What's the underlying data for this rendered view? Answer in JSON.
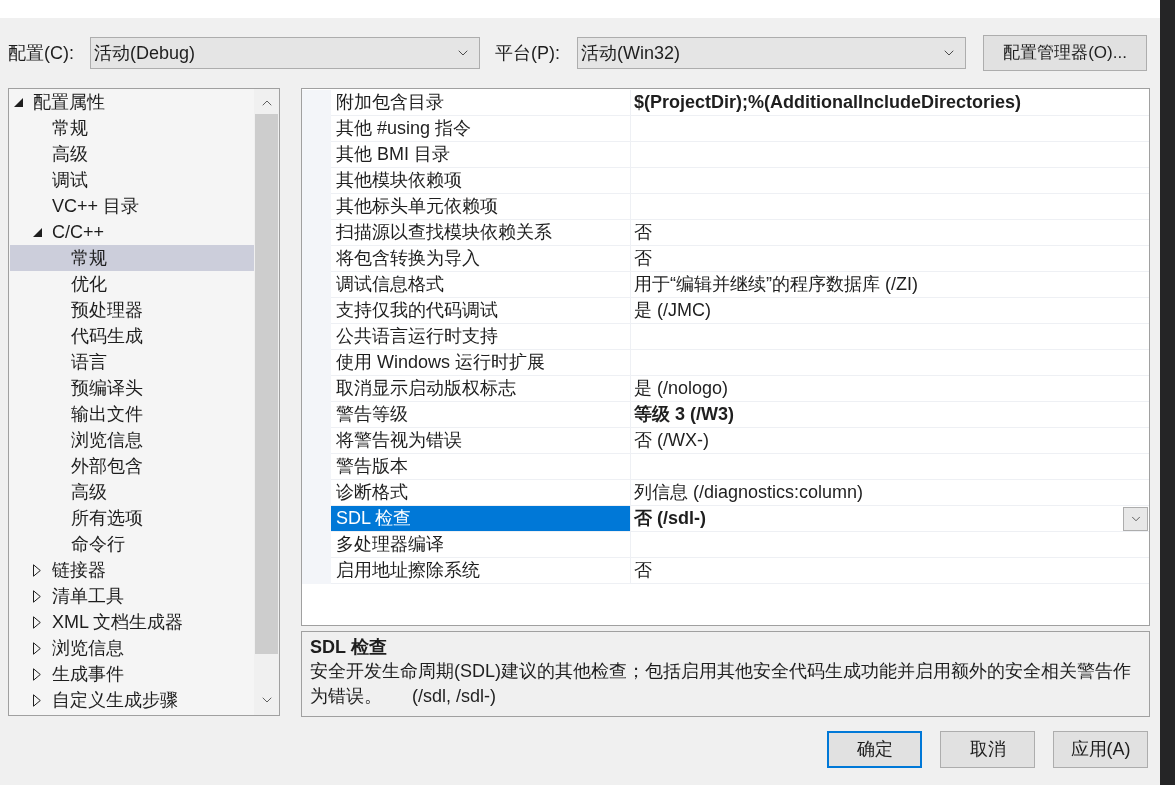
{
  "toolbar": {
    "configuration": {
      "label": "配置(C):",
      "value": "活动(Debug)"
    },
    "platform": {
      "label": "平台(P):",
      "value": "活动(Win32)"
    },
    "manager_button": "配置管理器(O)..."
  },
  "tree": [
    {
      "label": "配置属性",
      "expanded": true,
      "selected": false,
      "children": [
        {
          "label": "常规",
          "selected": false
        },
        {
          "label": "高级",
          "selected": false
        },
        {
          "label": "调试",
          "selected": false
        },
        {
          "label": "VC++ 目录",
          "selected": false
        },
        {
          "label": "C/C++",
          "expanded": true,
          "selected": false,
          "children": [
            {
              "label": "常规",
              "selected": true
            },
            {
              "label": "优化",
              "selected": false
            },
            {
              "label": "预处理器",
              "selected": false
            },
            {
              "label": "代码生成",
              "selected": false
            },
            {
              "label": "语言",
              "selected": false
            },
            {
              "label": "预编译头",
              "selected": false
            },
            {
              "label": "输出文件",
              "selected": false
            },
            {
              "label": "浏览信息",
              "selected": false
            },
            {
              "label": "外部包含",
              "selected": false
            },
            {
              "label": "高级",
              "selected": false
            },
            {
              "label": "所有选项",
              "selected": false
            },
            {
              "label": "命令行",
              "selected": false
            }
          ]
        },
        {
          "label": "链接器",
          "expanded": false,
          "selected": false
        },
        {
          "label": "清单工具",
          "expanded": false,
          "selected": false
        },
        {
          "label": "XML 文档生成器",
          "expanded": false,
          "selected": false
        },
        {
          "label": "浏览信息",
          "expanded": false,
          "selected": false
        },
        {
          "label": "生成事件",
          "expanded": false,
          "selected": false
        },
        {
          "label": "自定义生成步骤",
          "expanded": false,
          "selected": false
        }
      ]
    }
  ],
  "properties": [
    {
      "name": "附加包含目录",
      "value": "$(ProjectDir);%(AdditionalIncludeDirectories)",
      "modified": true,
      "selected": false
    },
    {
      "name": "其他 #using 指令",
      "selected": false
    },
    {
      "name": "其他 BMI 目录",
      "selected": false
    },
    {
      "name": "其他模块依赖项",
      "selected": false
    },
    {
      "name": "其他标头单元依赖项",
      "selected": false
    },
    {
      "name": "扫描源以查找模块依赖关系",
      "value": "否",
      "modified": false,
      "selected": false
    },
    {
      "name": "将包含转换为导入",
      "value": "否",
      "modified": false,
      "selected": false
    },
    {
      "name": "调试信息格式",
      "value": "用于“编辑并继续”的程序数据库 (/ZI)",
      "modified": false,
      "selected": false
    },
    {
      "name": "支持仅我的代码调试",
      "value": "是 (/JMC)",
      "modified": false,
      "selected": false
    },
    {
      "name": "公共语言运行时支持",
      "selected": false
    },
    {
      "name": "使用 Windows 运行时扩展",
      "selected": false
    },
    {
      "name": "取消显示启动版权标志",
      "value": "是 (/nologo)",
      "modified": false,
      "selected": false
    },
    {
      "name": "警告等级",
      "value": "等级 3 (/W3)",
      "modified": true,
      "selected": false
    },
    {
      "name": "将警告视为错误",
      "value": "否 (/WX-)",
      "modified": false,
      "selected": false
    },
    {
      "name": "警告版本",
      "selected": false
    },
    {
      "name": "诊断格式",
      "value": "列信息 (/diagnostics:column)",
      "modified": false,
      "selected": false
    },
    {
      "name": "SDL 检查",
      "value": "否 (/sdl-)",
      "modified": true,
      "selected": true
    },
    {
      "name": "多处理器编译",
      "selected": false
    },
    {
      "name": "启用地址擦除系统",
      "value": "否",
      "modified": false,
      "selected": false
    }
  ],
  "description": {
    "title": "SDL 检查",
    "text": "安全开发生命周期(SDL)建议的其他检查；包括启用其他安全代码生成功能并启用额外的安全相关警告作为错误。      (/sdl, /sdl-)"
  },
  "buttons": [
    {
      "label": "确定",
      "default": true
    },
    {
      "label": "取消",
      "default": false
    },
    {
      "label": "应用(A)",
      "default": false
    }
  ]
}
